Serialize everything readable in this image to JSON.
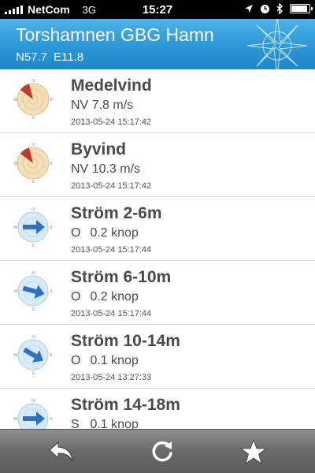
{
  "status_bar": {
    "carrier": "NetCom",
    "network": "3G",
    "time": "15:27"
  },
  "header": {
    "title": "Torshamnen GBG Hamn",
    "lat": "N57.7",
    "lon": "E11.8"
  },
  "colors": {
    "header_blue": "#2c97d7",
    "wind_arrow": "#c0392b",
    "current_arrow": "#2f6fc4"
  },
  "rows": [
    {
      "title": "Medelvind",
      "dir": "NV",
      "value": "7.8 m/s",
      "time": "2013-05-24 15:17:42",
      "icon": "wind-rose-icon"
    },
    {
      "title": "Byvind",
      "dir": "NV",
      "value": "10.3 m/s",
      "time": "2013-05-24 15:17:42",
      "icon": "wind-rose-icon"
    },
    {
      "title": "Ström 2-6m",
      "dir": "O",
      "value": "0.2 knop",
      "time": "2013-05-24 15:17:44",
      "icon": "current-compass-icon"
    },
    {
      "title": "Ström 6-10m",
      "dir": "O",
      "value": "0.2 knop",
      "time": "2013-05-24 15:17:44",
      "icon": "current-compass-icon"
    },
    {
      "title": "Ström 10-14m",
      "dir": "O",
      "value": "0.1 knop",
      "time": "2013-05-24 13:27:33",
      "icon": "current-compass-icon"
    },
    {
      "title": "Ström 14-18m",
      "dir": "S",
      "value": "0.1 knop",
      "time": "",
      "icon": "current-compass-icon"
    }
  ],
  "toolbar": {
    "back_icon": "back-arrow-icon",
    "refresh_icon": "refresh-icon",
    "favorite_icon": "star-icon"
  }
}
